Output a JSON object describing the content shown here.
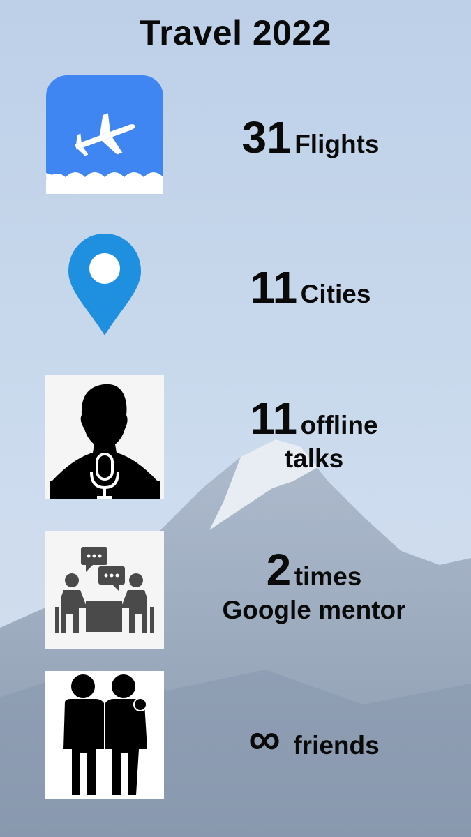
{
  "title": "Travel 2022",
  "stats": [
    {
      "number": "31",
      "label": "Flights",
      "icon": "airplane-icon"
    },
    {
      "number": "11",
      "label": "Cities",
      "icon": "location-pin-icon"
    },
    {
      "number": "11",
      "label": "offline",
      "label2": "talks",
      "icon": "speaker-microphone-icon"
    },
    {
      "number": "2",
      "label": "times",
      "label2": "Google mentor",
      "icon": "mentoring-meeting-icon"
    },
    {
      "number": "∞",
      "label": "friends",
      "icon": "friends-icon"
    }
  ],
  "colors": {
    "sky": "#c9d9eb",
    "mountain": "#8a9ab0",
    "airplane_tile": "#3f86f2",
    "pin": "#1f8fe0",
    "text": "#0a0a0a"
  }
}
